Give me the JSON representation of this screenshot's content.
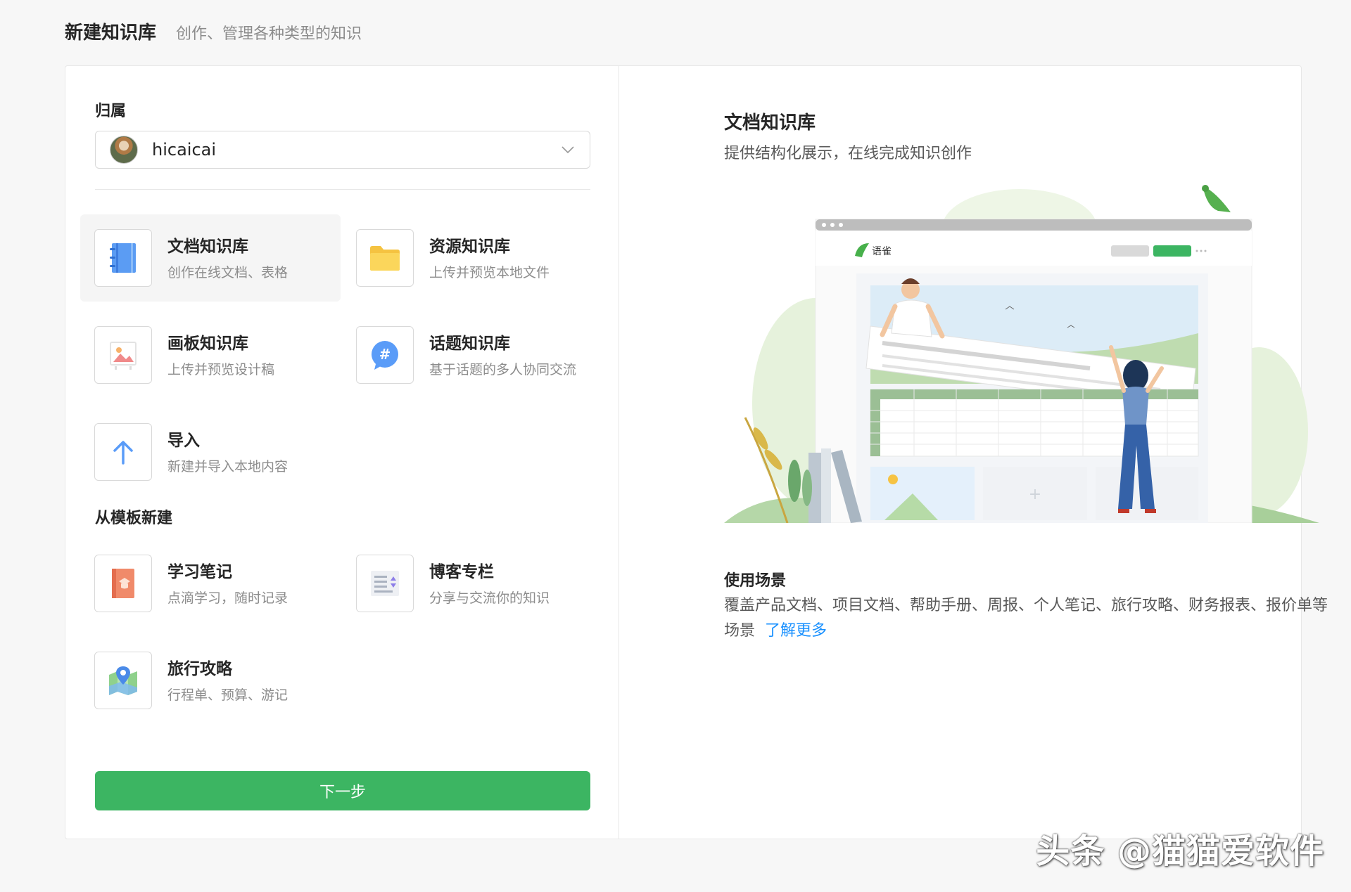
{
  "header": {
    "title": "新建知识库",
    "subtitle": "创作、管理各种类型的知识"
  },
  "owner": {
    "label": "归属",
    "selected": "hicaicai"
  },
  "types": [
    {
      "title": "文档知识库",
      "desc": "创作在线文档、表格",
      "selected": true
    },
    {
      "title": "资源知识库",
      "desc": "上传并预览本地文件",
      "selected": false
    },
    {
      "title": "画板知识库",
      "desc": "上传并预览设计稿",
      "selected": false
    },
    {
      "title": "话题知识库",
      "desc": "基于话题的多人协同交流",
      "selected": false
    },
    {
      "title": "导入",
      "desc": "新建并导入本地内容",
      "selected": false
    }
  ],
  "templates": {
    "label": "从模板新建",
    "items": [
      {
        "title": "学习笔记",
        "desc": "点滴学习，随时记录"
      },
      {
        "title": "博客专栏",
        "desc": "分享与交流你的知识"
      },
      {
        "title": "旅行攻略",
        "desc": "行程单、预算、游记"
      }
    ]
  },
  "next_label": "下一步",
  "preview": {
    "title": "文档知识库",
    "desc": "提供结构化展示，在线完成知识创作",
    "app_name": "语雀",
    "usage_title": "使用场景",
    "usage_text": "覆盖产品文档、项目文档、帮助手册、周报、个人笔记、旅行攻略、财务报表、报价单等场景",
    "learn_more": "了解更多"
  },
  "watermark": "头条 @猫猫爱软件",
  "colors": {
    "primary": "#3cb562",
    "link": "#1890ff",
    "border": "#d9d9d9"
  }
}
